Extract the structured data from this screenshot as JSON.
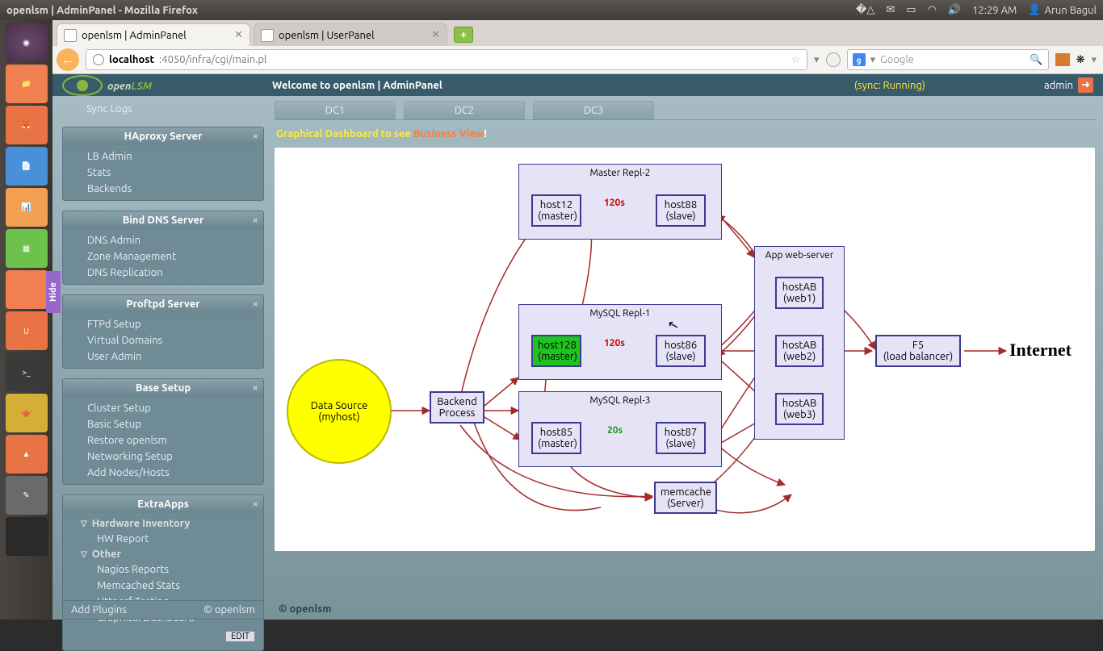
{
  "window_title": "openlsm | AdminPanel - Mozilla Firefox",
  "system": {
    "time": "12:29 AM",
    "user": "Arun Bagul"
  },
  "tabs": {
    "t1": "openlsm | AdminPanel",
    "t2": "openlsm | UserPanel"
  },
  "url": {
    "host": "localhost",
    "port_path": ":4050/infra/cgi/main.pl"
  },
  "search_placeholder": "Google",
  "appbar": {
    "brand1": "open",
    "brand2": "LSM",
    "welcome": "Welcome to openlsm | AdminPanel",
    "sync": "(sync: Running)",
    "user": "admin"
  },
  "sidebar": {
    "top": "Sync Logs",
    "haproxy": {
      "title": "HAproxy Server",
      "items": [
        "LB Admin",
        "Stats",
        "Backends"
      ]
    },
    "bind": {
      "title": "Bind DNS Server",
      "items": [
        "DNS Admin",
        "Zone Management",
        "DNS Replication"
      ]
    },
    "proftpd": {
      "title": "Proftpd Server",
      "items": [
        "FTPd Setup",
        "Virtual Domains",
        "User Admin"
      ]
    },
    "base": {
      "title": "Base Setup",
      "items": [
        "Cluster Setup",
        "Basic Setup",
        "Restore openlsm",
        "Networking Setup",
        "Add Nodes/Hosts"
      ]
    },
    "extra": {
      "title": "ExtraApps",
      "hw": "Hardware Inventory",
      "hw_items": [
        "HW Report"
      ],
      "other": "Other",
      "other_items": [
        "Nagios Reports",
        "Memcached Stats",
        "Httperf Testing",
        "Graphical Dashboard"
      ]
    },
    "edit": "EDIT",
    "footer": {
      "l": "Add Plugins",
      "r": "© openlsm"
    }
  },
  "dctabs": [
    "DC1",
    "DC2",
    "DC3"
  ],
  "dashboard": {
    "pre": "Graphical Dashboard to see ",
    "bv": "Business View",
    "ex": "!"
  },
  "diagram": {
    "datasource": {
      "l1": "Data Source",
      "l2": "(myhost)"
    },
    "backend": {
      "l1": "Backend",
      "l2": "Process"
    },
    "master2": {
      "title": "Master Repl-2",
      "m1": "host12",
      "m2": "(master)",
      "s1": "host88",
      "s2": "(slave)",
      "delay": "120s"
    },
    "mysql1": {
      "title": "MySQL Repl-1",
      "m1": "host128",
      "m2": "(master)",
      "s1": "host86",
      "s2": "(slave)",
      "delay": "120s"
    },
    "mysql3": {
      "title": "MySQL Repl-3",
      "m1": "host85",
      "m2": "(master)",
      "s1": "host87",
      "s2": "(slave)",
      "delay": "20s"
    },
    "memcache": {
      "l1": "memcache",
      "l2": "(Server)"
    },
    "appweb": {
      "title": "App web-server",
      "w1a": "hostAB",
      "w1b": "(web1)",
      "w2a": "hostAB",
      "w2b": "(web2)",
      "w3a": "hostAB",
      "w3b": "(web3)"
    },
    "f5": {
      "l1": "F5",
      "l2": "(load balancer)"
    },
    "internet": "Internet"
  },
  "footer": "© openlsm"
}
